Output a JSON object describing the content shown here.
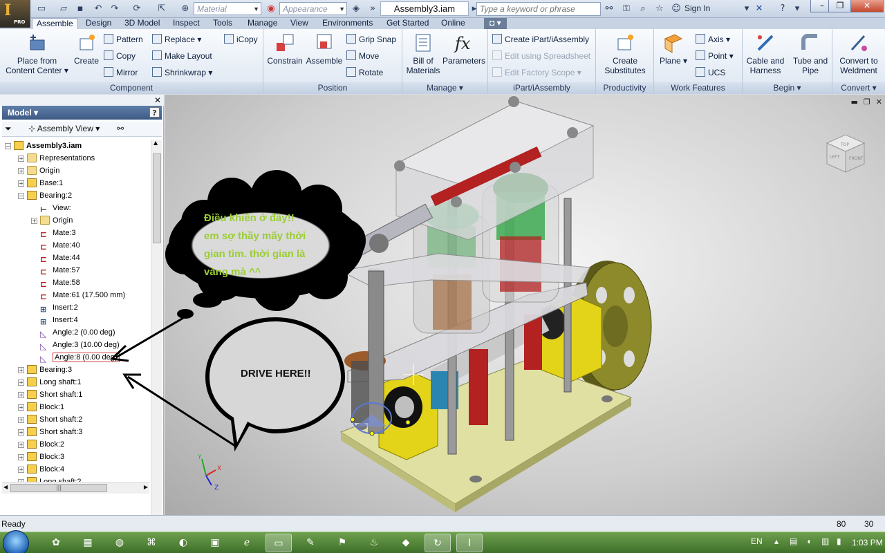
{
  "qat": {
    "material_placeholder": "Material",
    "appearance_placeholder": "Appearance",
    "document_title": "Assembly3.iam",
    "search_placeholder": "Type a keyword or phrase",
    "sign_in": "Sign In",
    "app_badge": "PRO",
    "app_letter": "I"
  },
  "tabs": [
    "Assemble",
    "Design",
    "3D Model",
    "Inspect",
    "Tools",
    "Manage",
    "View",
    "Environments",
    "Get Started",
    "Online"
  ],
  "ribbon": {
    "component": {
      "title": "Component",
      "place_from_content_center": "Place from Content Center",
      "create": "Create",
      "pattern": "Pattern",
      "copy": "Copy",
      "mirror": "Mirror",
      "replace": "Replace",
      "make_layout": "Make Layout",
      "shrinkwrap": "Shrinkwrap",
      "icopy": "iCopy"
    },
    "position": {
      "title": "Position",
      "constrain": "Constrain",
      "assemble": "Assemble",
      "grip_snap": "Grip Snap",
      "move": "Move",
      "rotate": "Rotate"
    },
    "manage": {
      "title": "Manage",
      "bill_of_materials": "Bill of Materials",
      "parameters": "Parameters"
    },
    "ipart": {
      "title": "iPart/iAssembly",
      "create": "Create iPart/iAssembly",
      "edit_spreadsheet": "Edit using Spreadsheet",
      "edit_factory_scope": "Edit Factory Scope"
    },
    "productivity": {
      "title": "Productivity",
      "create_substitutes": "Create Substitutes"
    },
    "work_features": {
      "title": "Work Features",
      "plane": "Plane",
      "axis": "Axis",
      "point": "Point",
      "ucs": "UCS"
    },
    "begin": {
      "title": "Begin",
      "cable_harness": "Cable and Harness",
      "tube_pipe": "Tube and Pipe"
    },
    "convert": {
      "title": "Convert",
      "convert_weldment": "Convert to Weldment"
    }
  },
  "browser": {
    "title": "Model",
    "view_label": "Assembly View",
    "tree": [
      {
        "label": "Assembly3.iam",
        "indent": 0,
        "icon": "part",
        "exp": "−",
        "bold": true
      },
      {
        "label": "Representations",
        "indent": 1,
        "icon": "fold",
        "exp": "+"
      },
      {
        "label": "Origin",
        "indent": 1,
        "icon": "fold",
        "exp": "+"
      },
      {
        "label": "Base:1",
        "indent": 1,
        "icon": "part",
        "exp": "+"
      },
      {
        "label": "Bearing:2",
        "indent": 1,
        "icon": "part",
        "exp": "−"
      },
      {
        "label": "View:",
        "indent": 2,
        "icon": "view",
        "exp": ""
      },
      {
        "label": "Origin",
        "indent": 2,
        "icon": "fold",
        "exp": "+"
      },
      {
        "label": "Mate:3",
        "indent": 2,
        "icon": "mate",
        "exp": ""
      },
      {
        "label": "Mate:40",
        "indent": 2,
        "icon": "mate",
        "exp": ""
      },
      {
        "label": "Mate:44",
        "indent": 2,
        "icon": "mate",
        "exp": ""
      },
      {
        "label": "Mate:57",
        "indent": 2,
        "icon": "mate",
        "exp": ""
      },
      {
        "label": "Mate:58",
        "indent": 2,
        "icon": "mate",
        "exp": ""
      },
      {
        "label": "Mate:61 (17.500 mm)",
        "indent": 2,
        "icon": "mate",
        "exp": ""
      },
      {
        "label": "Insert:2",
        "indent": 2,
        "icon": "ins",
        "exp": ""
      },
      {
        "label": "Insert:4",
        "indent": 2,
        "icon": "ins",
        "exp": ""
      },
      {
        "label": "Angle:2 (0.00 deg)",
        "indent": 2,
        "icon": "ang",
        "exp": ""
      },
      {
        "label": "Angle:3 (10.00 deg)",
        "indent": 2,
        "icon": "ang",
        "exp": ""
      },
      {
        "label": "Angle:8 (0.00 deg)",
        "indent": 2,
        "icon": "ang",
        "exp": "",
        "selected": true
      },
      {
        "label": "Bearing:3",
        "indent": 1,
        "icon": "part",
        "exp": "+"
      },
      {
        "label": "Long shaft:1",
        "indent": 1,
        "icon": "part",
        "exp": "+"
      },
      {
        "label": "Short shaft:1",
        "indent": 1,
        "icon": "part",
        "exp": "+"
      },
      {
        "label": "Block:1",
        "indent": 1,
        "icon": "part",
        "exp": "+"
      },
      {
        "label": "Short shaft:2",
        "indent": 1,
        "icon": "part",
        "exp": "+"
      },
      {
        "label": "Short shaft:3",
        "indent": 1,
        "icon": "part",
        "exp": "+"
      },
      {
        "label": "Block:2",
        "indent": 1,
        "icon": "part",
        "exp": "+"
      },
      {
        "label": "Block:3",
        "indent": 1,
        "icon": "part",
        "exp": "+"
      },
      {
        "label": "Block:4",
        "indent": 1,
        "icon": "part",
        "exp": "+"
      },
      {
        "label": "Long shaft:2",
        "indent": 1,
        "icon": "part",
        "exp": "+"
      }
    ]
  },
  "annotations": {
    "cloud_lines": [
      "Điều khiển ở đây!!",
      "em sợ thầy mấy thời",
      "gian tìm. thời gian là",
      "vàng mà ^^"
    ],
    "bubble_text": "DRIVE HERE!!"
  },
  "viewcube": {
    "top": "TOP",
    "left": "LEFT",
    "front": "FRONT"
  },
  "triad": {
    "x": "X",
    "y": "Y",
    "z": "Z"
  },
  "status": {
    "text": "Ready",
    "count1": "80",
    "count2": "30"
  },
  "tray": {
    "lang": "EN",
    "time": "1:03 PM"
  },
  "colors": {
    "accent": "#3d5a84",
    "annotation_green": "#9acd32",
    "ribbon_bg": "#eef3f9"
  }
}
